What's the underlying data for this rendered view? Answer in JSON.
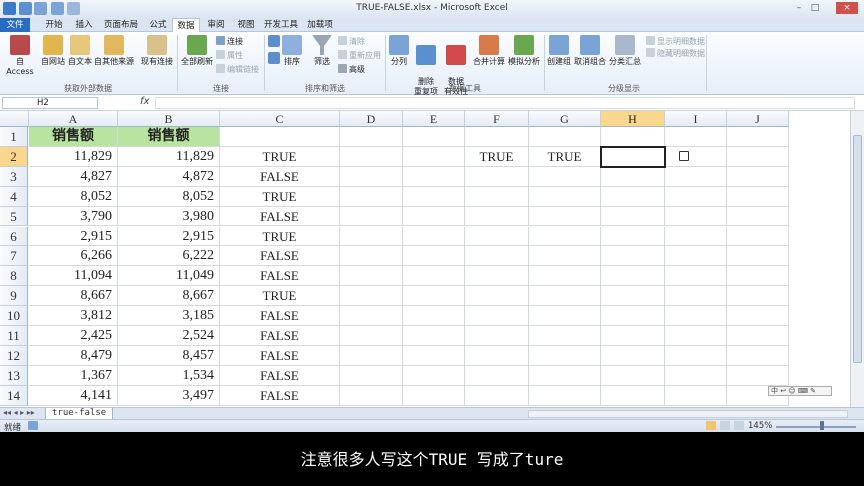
{
  "window": {
    "title": "TRUE-FALSE.xlsx - Microsoft Excel"
  },
  "tabs": [
    {
      "label": "文件"
    },
    {
      "label": "开始"
    },
    {
      "label": "插入"
    },
    {
      "label": "页面布局"
    },
    {
      "label": "公式"
    },
    {
      "label": "数据"
    },
    {
      "label": "审阅"
    },
    {
      "label": "视图"
    },
    {
      "label": "开发工具"
    },
    {
      "label": "加载项"
    }
  ],
  "ribbon": {
    "external": {
      "access": "自 Access",
      "web": "自网站",
      "text": "自文本",
      "other": "自其他来源",
      "existing": "现有连接",
      "group": "获取外部数据"
    },
    "connections": {
      "refresh_all": "全部刷新",
      "connections": "连接",
      "properties": "属性",
      "edit_links": "编辑链接",
      "group": "连接"
    },
    "sort_filter": {
      "sort": "排序",
      "filter": "筛选",
      "clear": "清除",
      "reapply": "重新应用",
      "advanced": "高级",
      "group": "排序和筛选"
    },
    "data_tools": {
      "split": "分列",
      "remove_dup": "删除\n重复项",
      "validation": "数据\n有效性",
      "consolidate": "合并计算",
      "what_if": "模拟分析",
      "group": "数据工具"
    },
    "outline": {
      "group_btn": "创建组",
      "ungroup": "取消组合",
      "subtotal": "分类汇总",
      "show_detail": "显示明细数据",
      "hide_detail": "隐藏明细数据",
      "group": "分级显示"
    }
  },
  "formula_bar": {
    "name_box": "H2",
    "fx": "fx",
    "value": ""
  },
  "columns": [
    "A",
    "B",
    "C",
    "D",
    "E",
    "F",
    "G",
    "H",
    "I",
    "J"
  ],
  "rows": [
    {
      "n": "1",
      "a": "销售额",
      "b": "销售额",
      "c": ""
    },
    {
      "n": "2",
      "a": "11,829",
      "b": "11,829",
      "c": "TRUE"
    },
    {
      "n": "3",
      "a": "4,827",
      "b": "4,872",
      "c": "FALSE"
    },
    {
      "n": "4",
      "a": "8,052",
      "b": "8,052",
      "c": "TRUE"
    },
    {
      "n": "5",
      "a": "3,790",
      "b": "3,980",
      "c": "FALSE"
    },
    {
      "n": "6",
      "a": "2,915",
      "b": "2,915",
      "c": "TRUE"
    },
    {
      "n": "7",
      "a": "6,266",
      "b": "6,222",
      "c": "FALSE"
    },
    {
      "n": "8",
      "a": "11,094",
      "b": "11,049",
      "c": "FALSE"
    },
    {
      "n": "9",
      "a": "8,667",
      "b": "8,667",
      "c": "TRUE"
    },
    {
      "n": "10",
      "a": "3,812",
      "b": "3,185",
      "c": "FALSE"
    },
    {
      "n": "11",
      "a": "2,425",
      "b": "2,524",
      "c": "FALSE"
    },
    {
      "n": "12",
      "a": "8,479",
      "b": "8,457",
      "c": "FALSE"
    },
    {
      "n": "13",
      "a": "1,367",
      "b": "1,534",
      "c": "FALSE"
    },
    {
      "n": "14",
      "a": "4,141",
      "b": "3,497",
      "c": "FALSE"
    }
  ],
  "extra_cells": {
    "F2": "TRUE",
    "G2": "TRUE"
  },
  "selected_cell": "H2",
  "sheet_tab": "true-false",
  "status": {
    "ready": "就绪",
    "zoom": "145%"
  },
  "caption": "注意很多人写这个TRUE 写成了ture",
  "colors": {
    "header_fill": "#b8e3a0",
    "selection_header": "#f9d78c",
    "file_tab": "#2a6cc4"
  }
}
